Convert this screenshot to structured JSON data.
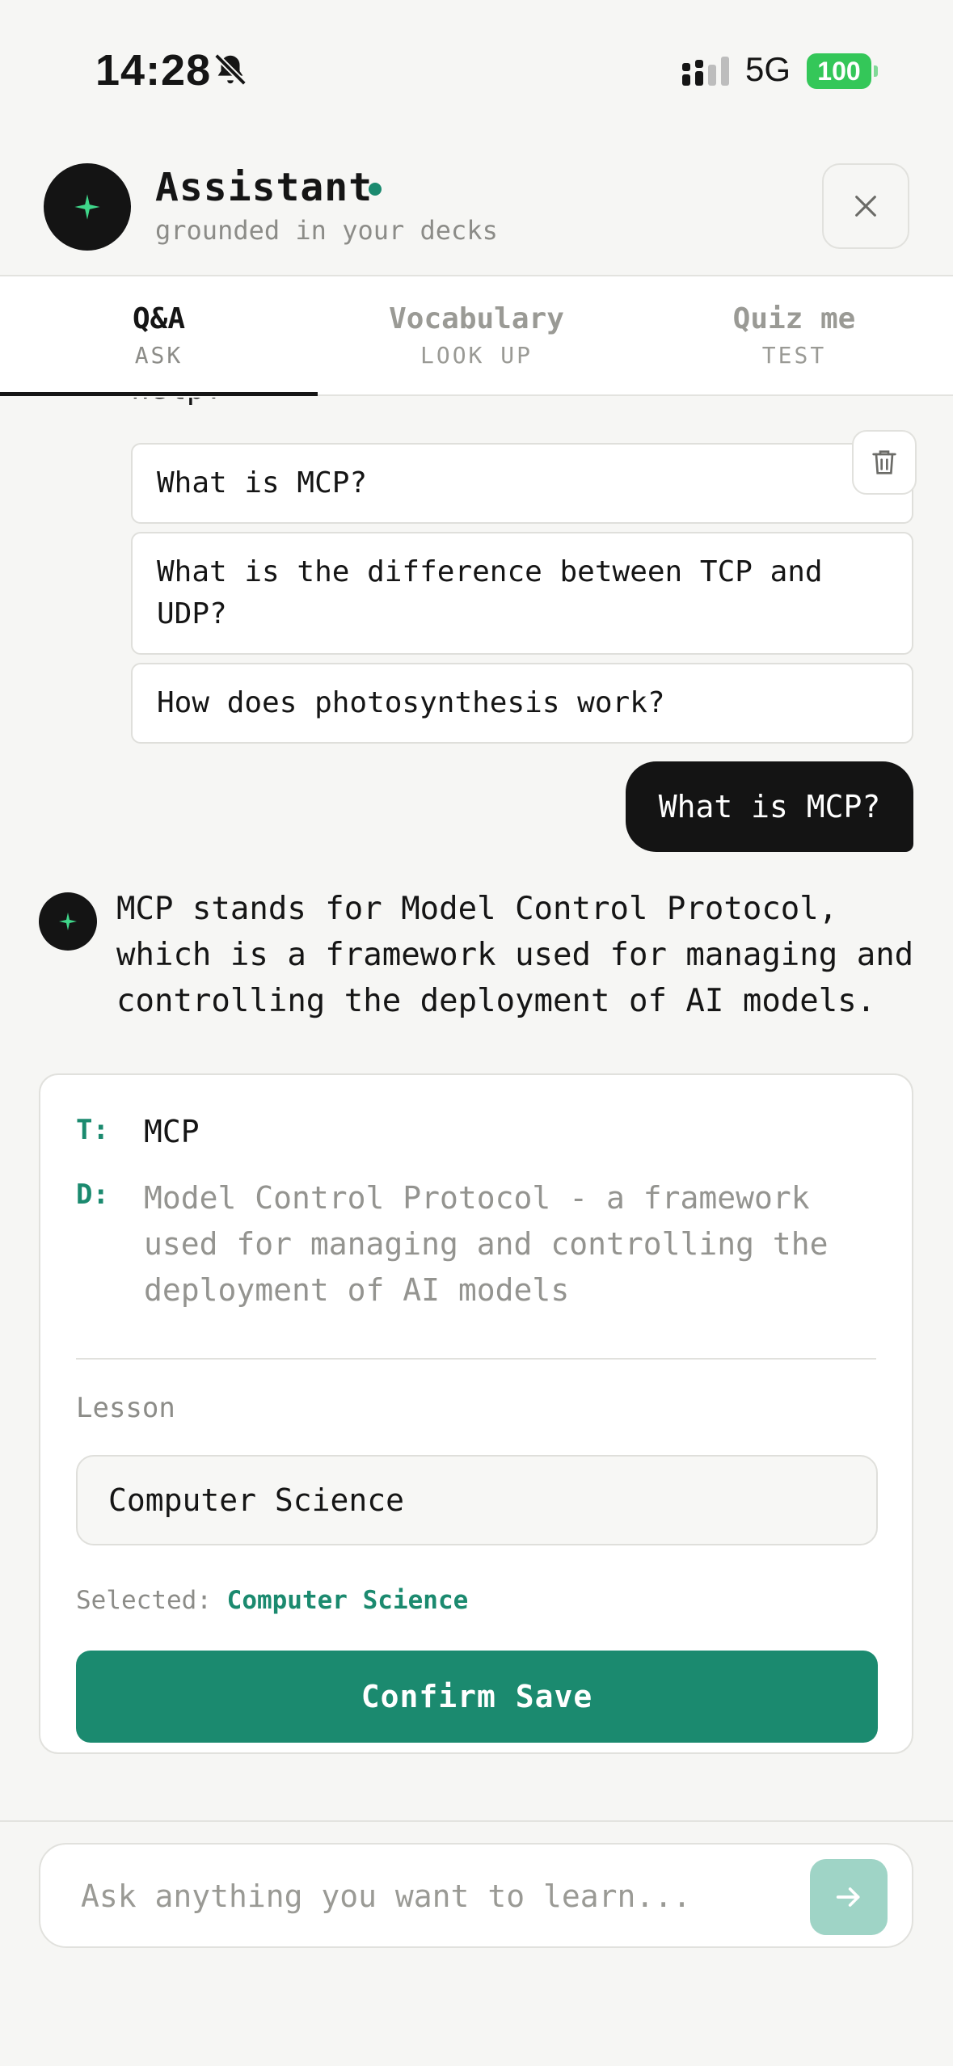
{
  "status_bar": {
    "time": "14:28",
    "network": "5G",
    "battery": "100"
  },
  "header": {
    "title": "Assistant",
    "subtitle": "grounded in your decks"
  },
  "tabs": [
    {
      "label": "Q&A",
      "sub": "ASK",
      "active": true
    },
    {
      "label": "Vocabulary",
      "sub": "LOOK UP",
      "active": false
    },
    {
      "label": "Quiz me",
      "sub": "TEST",
      "active": false
    }
  ],
  "chat": {
    "truncated_line": "help?",
    "suggestions": [
      "What is MCP?",
      "What is the difference between TCP and UDP?",
      "How does photosynthesis work?"
    ],
    "user_message": "What is MCP?",
    "bot_message": "MCP stands for Model Control Protocol, which is a framework used for managing and controlling the deployment of AI models."
  },
  "card": {
    "term_key": "T:",
    "term": "MCP",
    "definition_key": "D:",
    "definition": "Model Control Protocol - a framework used for managing and controlling the deployment of AI models",
    "lesson_label": "Lesson",
    "lesson_value": "Computer Science",
    "selected_prefix": "Selected:",
    "selected_value": "Computer Science",
    "confirm_label": "Confirm Save"
  },
  "composer": {
    "placeholder": "Ask anything you want to learn..."
  },
  "colors": {
    "accent": "#1b8a6f",
    "send_disabled": "#9fd4c6",
    "dark": "#141414",
    "battery": "#34c759",
    "sparkle": "#3fd68a"
  },
  "icons": [
    "bell-off-icon",
    "signal-icon",
    "sparkle-icon",
    "close-icon",
    "trash-icon",
    "arrow-right-icon"
  ]
}
